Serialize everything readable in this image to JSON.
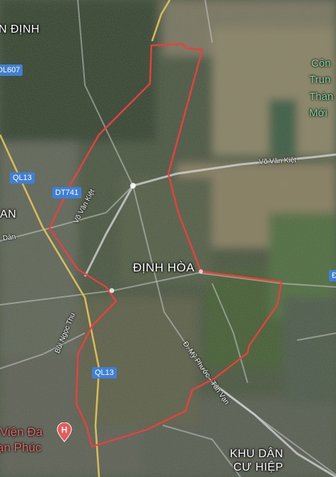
{
  "map": {
    "colors": {
      "boundary": "#e8403f",
      "major_road": "#e3c45a",
      "minor_road": "#c9c9c9",
      "shield": "#3f7fd6",
      "poi": "#e46a6a",
      "park_text": "#7fd79c"
    },
    "labels": {
      "dinh_hoa": "ĐỊNH HÒA",
      "tan_dinh": "N ĐỊNH",
      "an_left": "AN",
      "khu_dan_cu_1": "KHU DÂN",
      "khu_dan_cu_2": "CƯ HIỆP"
    },
    "roads": {
      "vo_van_kiet_east": "Võ Văn Kiệt",
      "vo_van_kiet_west": "Võ Văn Kiệt",
      "bui_ngoc_thu": "Bùi Ngọc Thu",
      "my_phuoc_tan_van": "Đ. Mỹ Phước - Tân Vạn",
      "dan_left": "Dàn"
    },
    "shields": {
      "ql607": "ĐL607",
      "ql13_top": "QL13",
      "dt741": "DT741",
      "ql13_bottom": "QL13",
      "d_right": "Đ"
    },
    "poi": {
      "hospital_line1": "Viện Đa",
      "hospital_line2": "ạn Phúc",
      "hospital_icon": "hospital-icon"
    },
    "park": {
      "line1": "Côn",
      "line2": "Trun",
      "line3": "Thàn",
      "line4": "Mới"
    }
  }
}
